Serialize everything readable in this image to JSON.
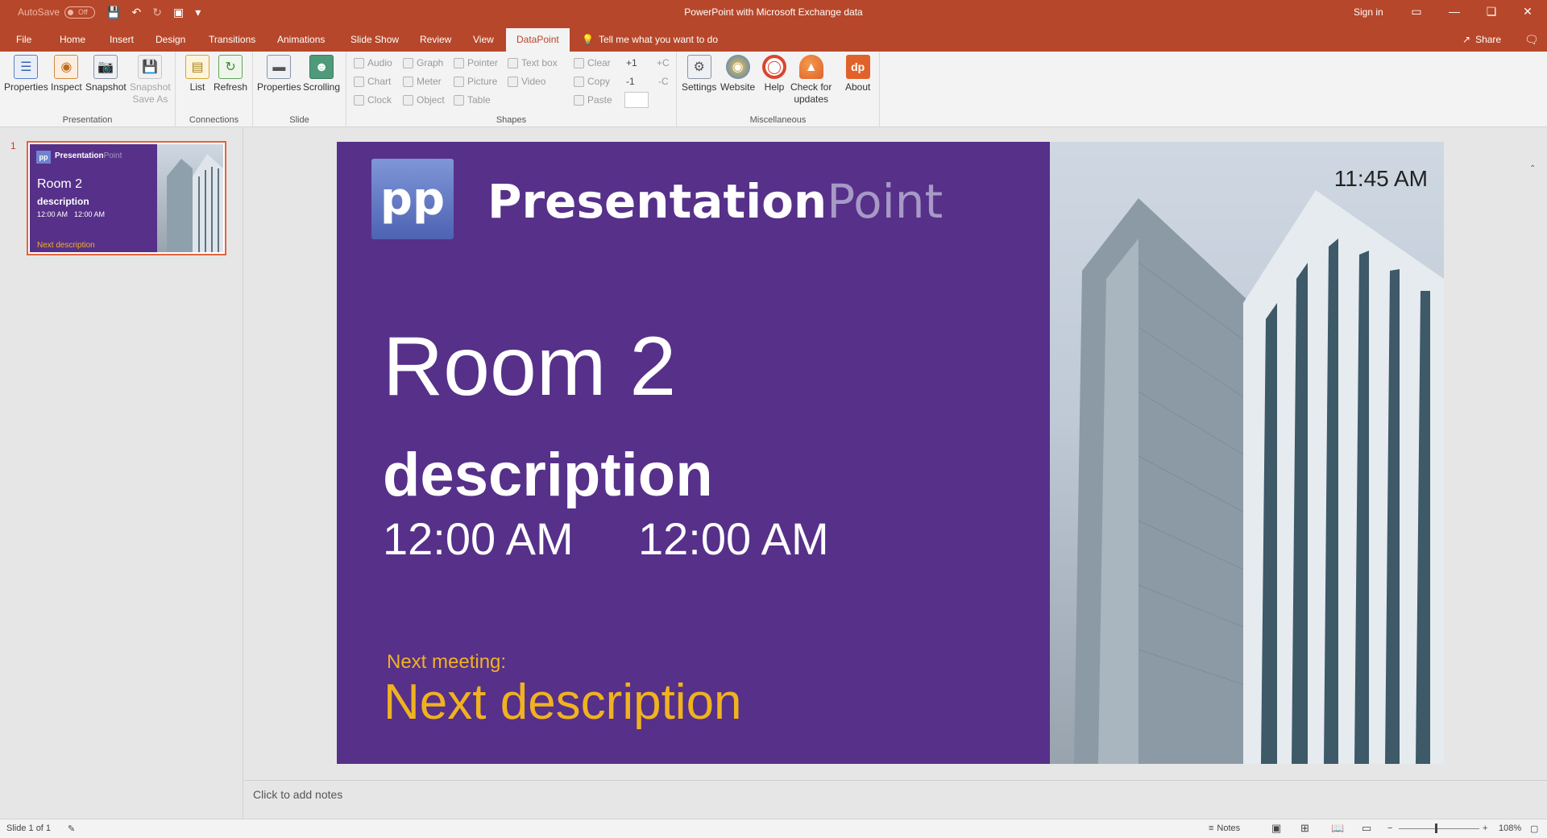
{
  "titlebar": {
    "autosave_label": "AutoSave",
    "autosave_state": "Off",
    "doc_title": "PowerPoint with Microsoft Exchange data",
    "sign_in": "Sign in"
  },
  "tabs": [
    {
      "label": "File"
    },
    {
      "label": "Home"
    },
    {
      "label": "Insert"
    },
    {
      "label": "Design"
    },
    {
      "label": "Transitions"
    },
    {
      "label": "Animations"
    },
    {
      "label": "Slide Show"
    },
    {
      "label": "Review"
    },
    {
      "label": "View"
    },
    {
      "label": "DataPoint",
      "active": true
    }
  ],
  "tell_me": "Tell me what you want to do",
  "share": "Share",
  "ribbon": {
    "presentation": {
      "label": "Presentation",
      "buttons": [
        "Properties",
        "Inspect",
        "Snapshot",
        "Snapshot",
        "Save As"
      ]
    },
    "connections": {
      "label": "Connections",
      "buttons": [
        "List",
        "Refresh"
      ]
    },
    "slide": {
      "label": "Slide",
      "buttons": [
        "Properties",
        "Scrolling"
      ]
    },
    "shapes": {
      "label": "Shapes",
      "small": [
        "Audio",
        "Graph",
        "Pointer",
        "Text box",
        "Clear",
        "+1",
        "+C",
        "Chart",
        "Meter",
        "Picture",
        "Video",
        "Copy",
        "-1",
        "-C",
        "Clock",
        "Object",
        "Table",
        "Paste"
      ]
    },
    "misc": {
      "label": "Miscellaneous",
      "buttons": [
        "Settings",
        "Website",
        "Help",
        "Check for",
        "updates",
        "About"
      ]
    }
  },
  "thumbnail": {
    "number": "1",
    "brand_bold": "Presentation",
    "brand_light": "Point",
    "room": "Room 2",
    "description": "description",
    "time1": "12:00 AM",
    "time2": "12:00 AM",
    "next": "Next description"
  },
  "slide": {
    "logo": "pp",
    "brand_bold": "Presentation",
    "brand_light": "Point",
    "clock": "11:45 AM",
    "room": "Room 2",
    "description": "description",
    "time_start": "12:00 AM",
    "time_end": "12:00 AM",
    "next_label": "Next meeting:",
    "next_description": "Next description"
  },
  "notes_placeholder": "Click to add notes",
  "status": {
    "slide_count": "Slide 1 of 1",
    "notes": "Notes",
    "zoom": "108%"
  }
}
